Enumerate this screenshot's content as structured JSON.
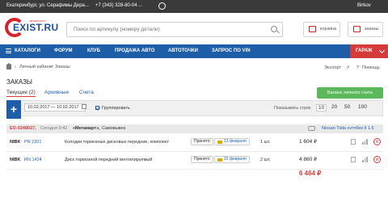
{
  "topbar": {
    "location": "Екатеринбург, ул. Серафимы Дера...",
    "phone": "+7 (343) 328-80-04 ...",
    "user": "Birkov"
  },
  "header": {
    "logo_text": "EXIST.RU",
    "logo_subtext": "АВТОЗАПЧАСТИ",
    "search_placeholder": "Поиск по артикулу (номеру детали)",
    "cart_label": "корзина",
    "orders_label": "заказы"
  },
  "nav": {
    "items": [
      "КАТАЛОГИ",
      "ФОРУМ",
      "КЛУБ",
      "ПРОДАЖА АВТО",
      "АВТОТОЧКИ",
      "ЗАПРОС ПО VIN"
    ],
    "garage": "ГАРАЖ"
  },
  "breadcrumbs": [
    "Личный кабинет",
    "Заказы"
  ],
  "tools": {
    "export": "Экспорт",
    "help": "Помощь"
  },
  "page_title": "ЗАКАЗЫ",
  "tabs": [
    "Текущие (2)",
    "Архивные",
    "Счета"
  ],
  "balance_button": "Баланс личного счета",
  "filter": {
    "date_range": "10.02.2017 — 10.02.2017",
    "group_label": "Группировать",
    "show_rows_label": "Показывать строк",
    "page_sizes": [
      "10",
      "20",
      "50",
      "100"
    ],
    "active_page_size": "10"
  },
  "order": {
    "id": "EO-0248027,",
    "date": "Сегодня 9:42",
    "store": "«Мегамарт»,",
    "city": "Самовывоз",
    "car": "Nissan Tiida хэтчбек II 1.6"
  },
  "rows": [
    {
      "brand": "NIBK",
      "part_number": "PN 2201",
      "description": "Колодки тормозные дисковые передние, комплект",
      "status": "Принято",
      "delivery_date": "13 февраля",
      "qty": "1 шт.",
      "price": "1 604",
      "currency": "₽"
    },
    {
      "brand": "NIBK",
      "part_number": "RN 1424",
      "description": "Диск тормозной передний вентилируемый",
      "status": "Принято",
      "delivery_date": "15 февраля",
      "qty": "2 шт.",
      "price": "4 860",
      "currency": "₽"
    }
  ],
  "total": "6 464 ₽",
  "colors": {
    "nav_bg": "#1e5ea8",
    "accent_red": "#d63b3b",
    "green": "#5cb85c",
    "topbar_bg": "#3a3a3a"
  }
}
